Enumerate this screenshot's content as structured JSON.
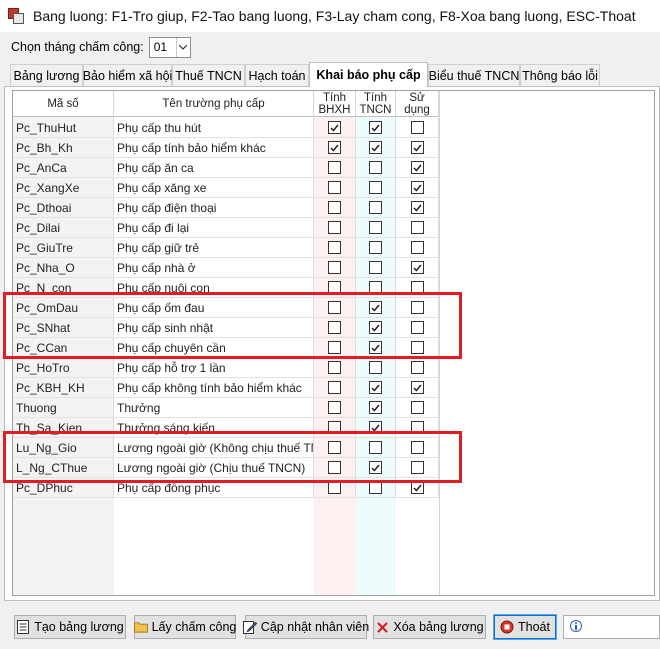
{
  "window": {
    "title": "Bang luong: F1-Tro giup, F2-Tao bang luong, F3-Lay cham cong, F8-Xoa bang luong, ESC-Thoat",
    "icon": "app-icon"
  },
  "month": {
    "label": "Chọn tháng chấm công:",
    "value": "01"
  },
  "tabs": [
    {
      "label": "Bảng lương"
    },
    {
      "label": "Bảo hiểm xã hội"
    },
    {
      "label": "Thuế TNCN"
    },
    {
      "label": "Hạch toán"
    },
    {
      "label": "Khai báo phụ cấp",
      "active": true
    },
    {
      "label": "Biểu thuế TNCN"
    },
    {
      "label": "Thông báo lỗi"
    }
  ],
  "grid": {
    "headers": {
      "code": "Mã số",
      "name": "Tên trường phụ cấp",
      "bhxh": "Tính BHXH",
      "tncn": "Tính TNCN",
      "use": "Sử dụng"
    },
    "rows": [
      {
        "code": "Pc_ThuHut",
        "name": "Phụ cấp thu hút",
        "bhxh": true,
        "tncn": true,
        "use": false
      },
      {
        "code": "Pc_Bh_Kh",
        "name": "Phụ cấp tính bảo hiểm khác",
        "bhxh": true,
        "tncn": true,
        "use": true
      },
      {
        "code": "Pc_AnCa",
        "name": "Phụ cấp ăn ca",
        "bhxh": false,
        "tncn": false,
        "use": true
      },
      {
        "code": "Pc_XangXe",
        "name": "Phụ cấp xăng xe",
        "bhxh": false,
        "tncn": false,
        "use": true
      },
      {
        "code": "Pc_Dthoai",
        "name": "Phụ cấp điện thoại",
        "bhxh": false,
        "tncn": false,
        "use": true
      },
      {
        "code": "Pc_Dilai",
        "name": "Phụ cấp đi lại",
        "bhxh": false,
        "tncn": false,
        "use": false
      },
      {
        "code": "Pc_GiuTre",
        "name": "Phụ cấp giữ trẻ",
        "bhxh": false,
        "tncn": false,
        "use": false
      },
      {
        "code": "Pc_Nha_O",
        "name": "Phụ cấp nhà ở",
        "bhxh": false,
        "tncn": false,
        "use": true
      },
      {
        "code": "Pc_N_con",
        "name": "Phụ cấp nuôi con",
        "bhxh": false,
        "tncn": false,
        "use": false
      },
      {
        "code": "Pc_OmDau",
        "name": "Phụ cấp ốm đau",
        "bhxh": false,
        "tncn": true,
        "use": false
      },
      {
        "code": "Pc_SNhat",
        "name": "Phụ cấp sinh nhật",
        "bhxh": false,
        "tncn": true,
        "use": false
      },
      {
        "code": "Pc_CCan",
        "name": "Phụ cấp chuyên cần",
        "bhxh": false,
        "tncn": true,
        "use": false
      },
      {
        "code": "Pc_HoTro",
        "name": "Phụ cấp hỗ trợ 1 lần",
        "bhxh": false,
        "tncn": false,
        "use": false
      },
      {
        "code": "Pc_KBH_KH",
        "name": "Phụ cấp không tính bảo hiểm khác",
        "bhxh": false,
        "tncn": true,
        "use": true
      },
      {
        "code": "Thuong",
        "name": "Thưởng",
        "bhxh": false,
        "tncn": true,
        "use": false
      },
      {
        "code": "Th_Sa_Kien",
        "name": "Thưởng sáng kiến",
        "bhxh": false,
        "tncn": true,
        "use": false
      },
      {
        "code": "Lu_Ng_Gio",
        "name": "Lương ngoài giờ (Không chịu thuế TNCN",
        "bhxh": false,
        "tncn": false,
        "use": false
      },
      {
        "code": "L_Ng_CThue",
        "name": "Lương ngoài giờ (Chịu thuế TNCN)",
        "bhxh": false,
        "tncn": true,
        "use": false
      },
      {
        "code": "Pc_DPhuc",
        "name": "Phụ cấp đồng phục",
        "bhxh": false,
        "tncn": false,
        "use": true
      }
    ]
  },
  "buttons": {
    "create": {
      "label": "Tạo bảng lương",
      "icon": "document-icon"
    },
    "attendance": {
      "label": "Lấy chấm công",
      "icon": "folder-icon"
    },
    "update": {
      "label": "Cập nhật nhân viên",
      "icon": "edit-icon"
    },
    "delete": {
      "label": "Xóa bảng lương",
      "icon": "delete-x-icon"
    },
    "exit": {
      "label": "Thoát",
      "icon": "stop-icon"
    }
  },
  "help_icon": "help-info-icon",
  "colors": {
    "highlight": "#e31b23",
    "bhxh_col": "#fdf0f0",
    "tncn_col": "#eefcfd",
    "code_col": "#f3f3f3"
  }
}
